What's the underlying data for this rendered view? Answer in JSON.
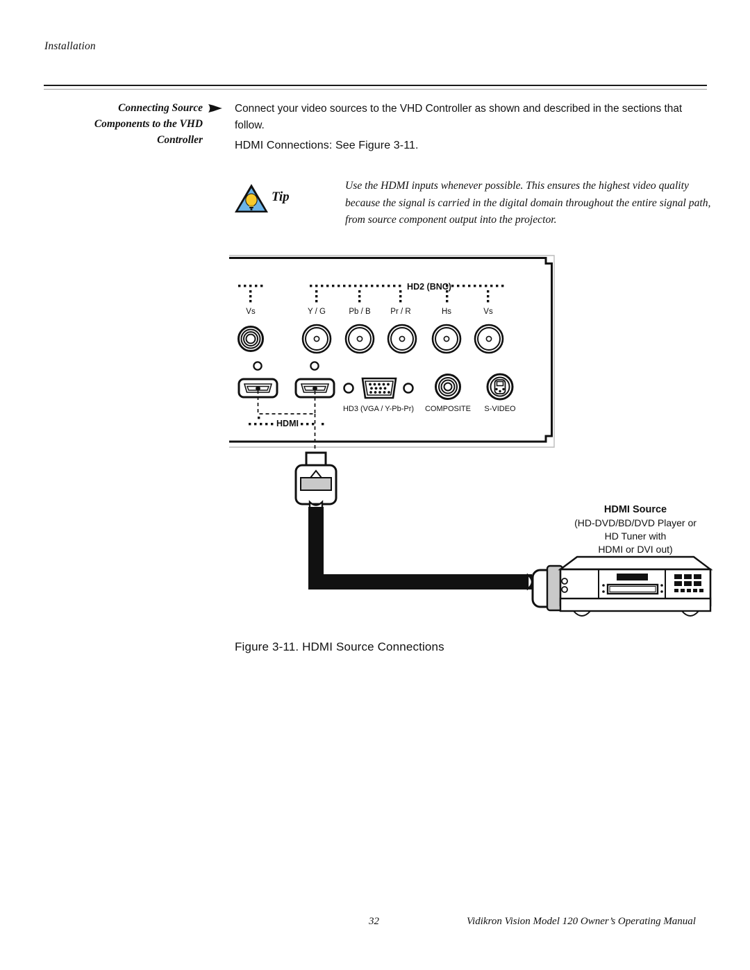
{
  "header": {
    "running_head": "Installation"
  },
  "section": {
    "heading_line1": "Connecting Source",
    "heading_line2": "Components to the VHD",
    "heading_line3": "Controller",
    "arrow_icon": "right-triangle-bullet-icon"
  },
  "body": {
    "intro_paragraph": "Connect your video sources to the VHD Controller as shown and described in the sections that follow.",
    "subheading": "HDMI Connections: See Figure 3-11."
  },
  "tip": {
    "icon": "tip-lightbulb-triangle-icon",
    "label": "Tip",
    "text": "Use the HDMI inputs whenever possible. This ensures the highest video quality because the signal is carried in the digital domain throughout the entire signal path, from source component output into the projector.",
    "triangle_fill": "#6cb4e8",
    "bulb_fill": "#f7c92b"
  },
  "figure": {
    "caption": "Figure 3-11. HDMI Source Connections",
    "panel": {
      "group_label_hd2": "HD2 (BNC)",
      "group_label_hdmi": "HDMI",
      "connector_labels": {
        "vs_left": "Vs",
        "y_g": "Y / G",
        "pb_b": "Pb / B",
        "pr_r": "Pr / R",
        "hs": "Hs",
        "vs_right": "Vs"
      },
      "bottom_labels": {
        "hd3": "HD3 (VGA / Y-Pb-Pr)",
        "composite": "COMPOSITE",
        "svideo": "S-VIDEO"
      }
    },
    "source": {
      "title": "HDMI Source",
      "desc_line1": "(HD-DVD/BD/DVD Player or",
      "desc_line2": "HD Tuner with",
      "desc_line3": "HDMI or DVI out)"
    }
  },
  "footer": {
    "page_number": "32",
    "manual_title": "Vidikron Vision Model 120 Owner’s Operating Manual"
  }
}
